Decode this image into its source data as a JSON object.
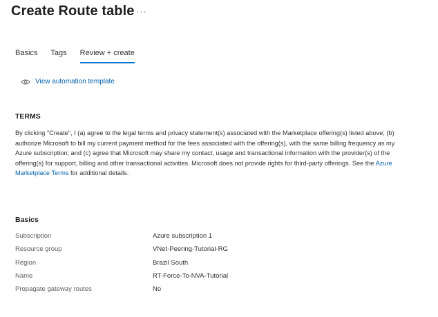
{
  "header": {
    "title": "Create Route table",
    "more": "···"
  },
  "tabs": [
    {
      "label": "Basics",
      "active": false
    },
    {
      "label": "Tags",
      "active": false
    },
    {
      "label": "Review + create",
      "active": true
    }
  ],
  "automation": {
    "icon": "eye-icon",
    "label": "View automation template"
  },
  "terms": {
    "heading": "TERMS",
    "text_before_link": "By clicking \"Create\", I (a) agree to the legal terms and privacy statement(s) associated with the Marketplace offering(s) listed above; (b) authorize Microsoft to bill my current payment method for the fees associated with the offering(s), with the same billing frequency as my Azure subscription; and (c) agree that Microsoft may share my contact, usage and transactional information with the provider(s) of the offering(s) for support, billing and other transactional activities. Microsoft does not provide rights for third-party offerings. See the ",
    "link_text": "Azure Marketplace Terms",
    "text_after_link": " for additional details."
  },
  "basics": {
    "heading": "Basics",
    "rows": [
      {
        "label": "Subscription",
        "value": "Azure subscription 1"
      },
      {
        "label": "Resource group",
        "value": "VNet-Peering-Tutorial-RG"
      },
      {
        "label": "Region",
        "value": "Brazil South"
      },
      {
        "label": "Name",
        "value": "RT-Force-To-NVA-Tutorial"
      },
      {
        "label": "Propagate gateway routes",
        "value": "No"
      }
    ]
  },
  "colors": {
    "accent": "#0078d4",
    "link": "#0062ad"
  }
}
